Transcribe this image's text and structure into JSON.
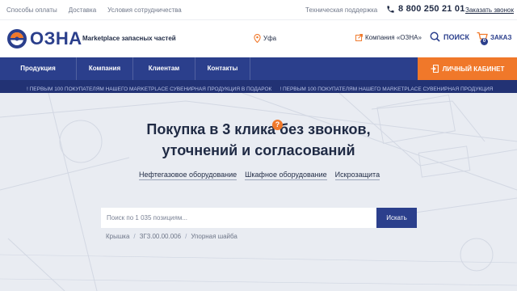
{
  "topbar": {
    "links": [
      "Способы оплаты",
      "Доставка",
      "Условия сотрудничества"
    ],
    "support": "Техническая поддержка",
    "phone": "8 800 250 21 01",
    "callback": "Заказать звонок"
  },
  "header": {
    "logo_text": "ОЗНА",
    "tagline": "Marketplace запасных частей",
    "city": "Уфа",
    "company_link": "Компания «ОЗНА»",
    "search_label": "ПОИСК",
    "cart_label": "ЗАКАЗ",
    "cart_count": "0"
  },
  "nav": {
    "items": [
      "Продукция",
      "Компания",
      "Клиентам",
      "Контакты"
    ],
    "cabinet": "ЛИЧНЫЙ КАБИНЕТ"
  },
  "ticker": {
    "text": "! ПЕРВЫМ 100 ПОКУПАТЕЛЯМ НАШЕГО MARKETPLACE СУВЕНИРНАЯ ПРОДУКЦИЯ В ПОДАРОК",
    "text2": "! ПЕРВЫМ 100 ПОКУПАТЕЛЯМ НАШЕГО MARKETPLACE СУВЕНИРНАЯ ПРОДУКЦИЯ"
  },
  "hero": {
    "title_line1": "Покупка в 3 клика  без звонков,",
    "title_line2": "уточнений и согласований",
    "qmark": "?",
    "categories": [
      "Нефтегазовое оборудование",
      "Шкафное оборудование",
      "Искрозащита"
    ],
    "search_placeholder": "Поиск по 1 035 позициям...",
    "search_button": "Искать",
    "examples": [
      "Крышка",
      "ЗГ3.00.00.006",
      "Упорная шайба"
    ],
    "separator": "/"
  },
  "colors": {
    "brand_blue": "#2b3f8c",
    "accent_orange": "#f0782a",
    "ticker_bg": "#223274",
    "hero_bg": "#e8ebf2"
  }
}
